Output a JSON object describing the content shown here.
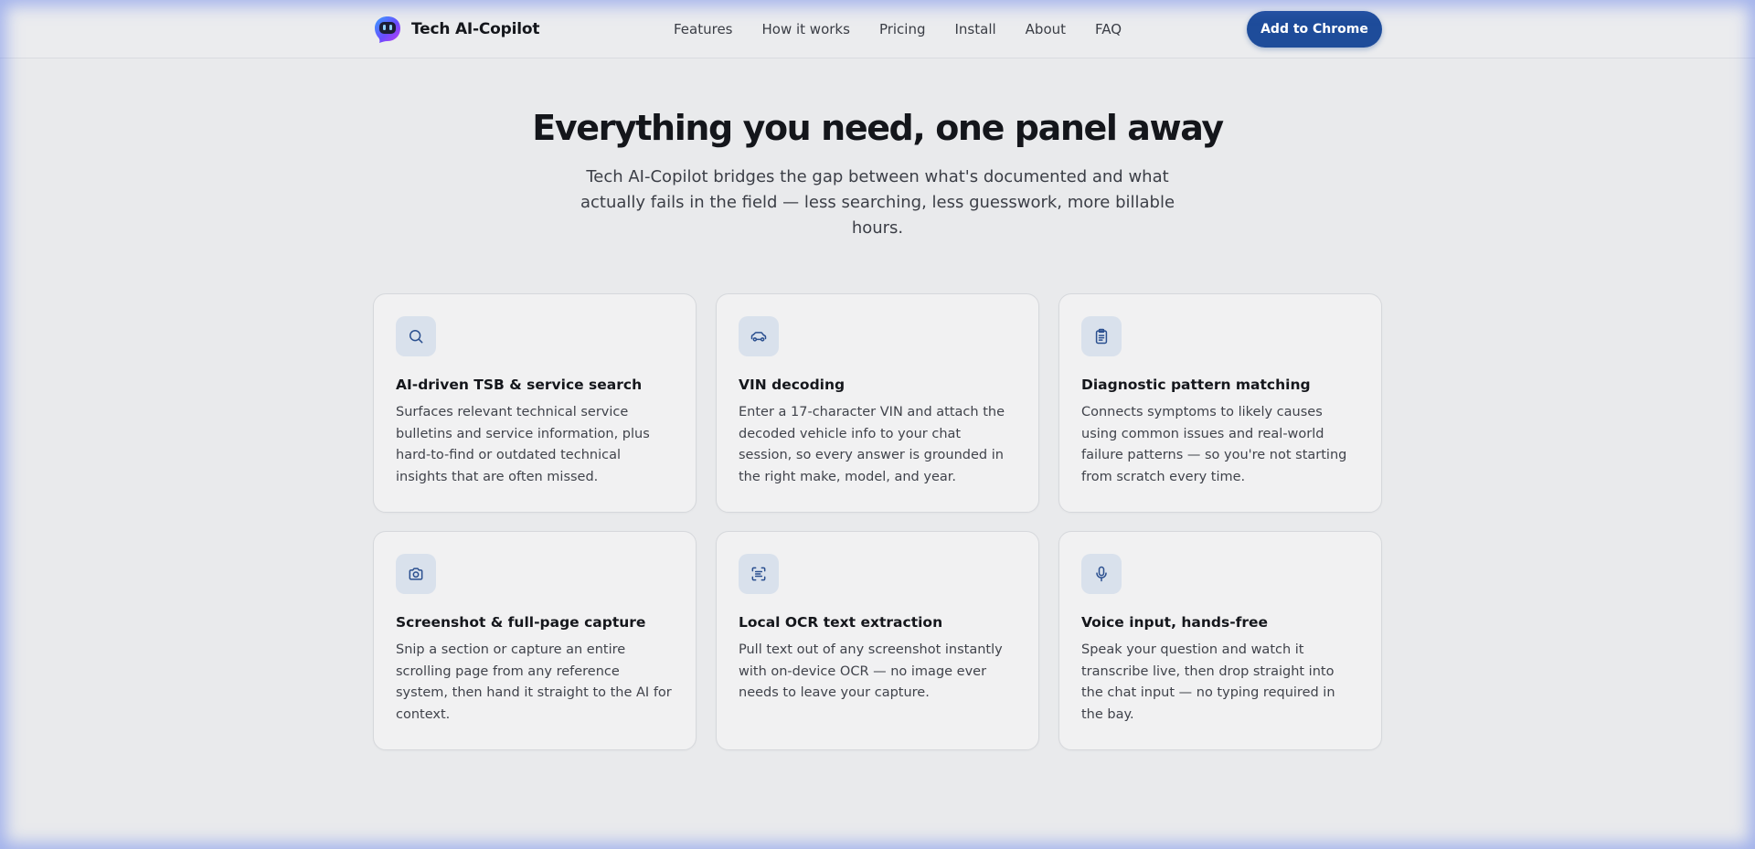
{
  "brand": {
    "name": "Tech AI-Copilot",
    "logo_icon": "robot-logo-icon"
  },
  "nav": {
    "items": [
      "Features",
      "How it works",
      "Pricing",
      "Install",
      "About",
      "FAQ"
    ]
  },
  "cta": {
    "label": "Add to Chrome",
    "color": "#1e4c9a"
  },
  "hero": {
    "title": "Everything you need, one panel away",
    "subtitle": "Tech AI-Copilot bridges the gap between what's documented and what actually fails in the field — less searching, less guesswork, more billable hours."
  },
  "features": [
    {
      "icon": "search-icon",
      "title": "AI-driven TSB & service search",
      "body": "Surfaces relevant technical service bulletins and service information, plus hard-to-find or outdated technical insights that are often missed."
    },
    {
      "icon": "car-icon",
      "title": "VIN decoding",
      "body": "Enter a 17-character VIN and attach the decoded vehicle info to your chat session, so every answer is grounded in the right make, model, and year."
    },
    {
      "icon": "clipboard-icon",
      "title": "Diagnostic pattern matching",
      "body": "Connects symptoms to likely causes using common issues and real-world failure patterns — so you're not starting from scratch every time."
    },
    {
      "icon": "camera-icon",
      "title": "Screenshot & full-page capture",
      "body": "Snip a section or capture an entire scrolling page from any reference system, then hand it straight to the AI for context."
    },
    {
      "icon": "scan-text-icon",
      "title": "Local OCR text extraction",
      "body": "Pull text out of any screenshot instantly with on-device OCR — no image ever needs to leave your capture."
    },
    {
      "icon": "microphone-icon",
      "title": "Voice input, hands-free",
      "body": "Speak your question and watch it transcribe live, then drop straight into the chat input — no typing required in the bay."
    }
  ],
  "colors": {
    "background": "#e9eaec",
    "icon_stroke": "#2a4f8f",
    "icon_bg": "#d9e1ec"
  }
}
